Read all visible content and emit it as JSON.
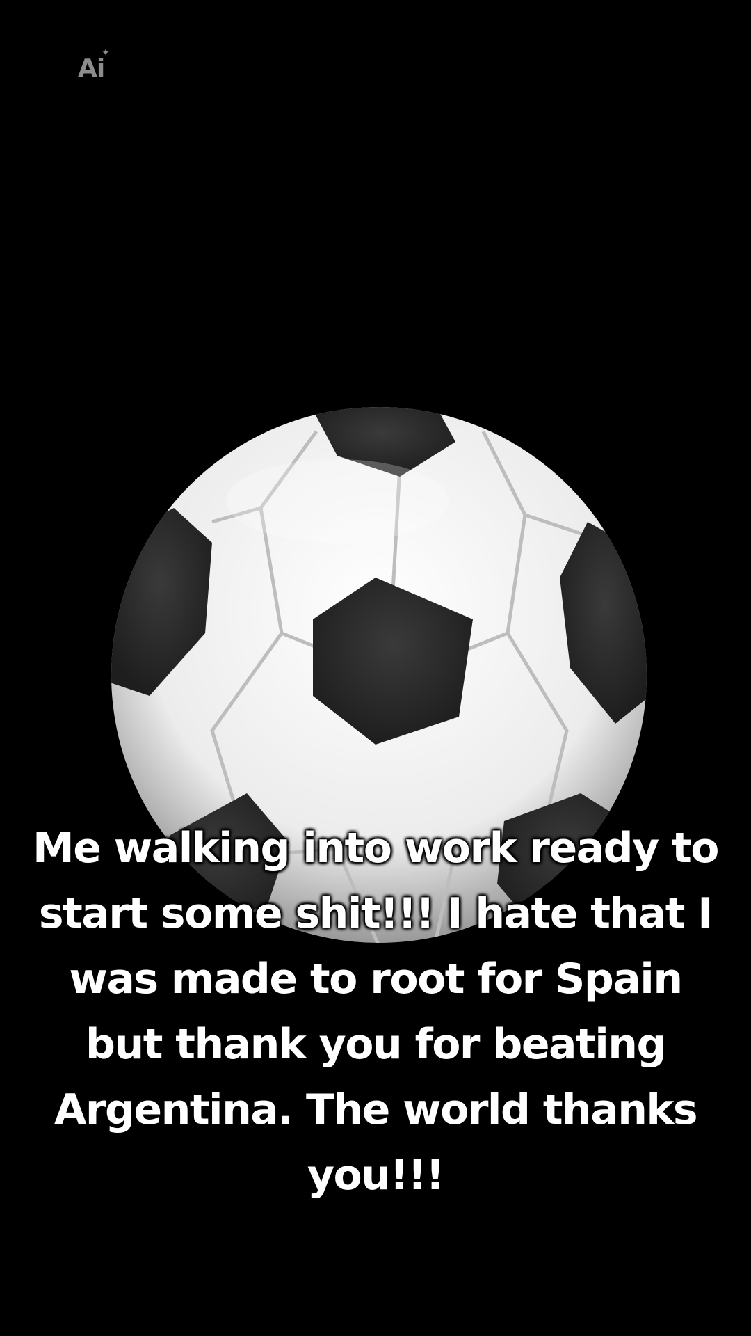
{
  "badge": {
    "label": "Ai"
  },
  "image": {
    "subject": "soccer-ball-icon"
  },
  "caption": {
    "text": "Me walking into work ready to start some shit!!! I hate that I was made to root for Spain but thank you for beating Argentina. The world thanks you!!!"
  },
  "colors": {
    "background": "#000000",
    "caption": "#ffffff",
    "badge": "#8c8c8c"
  }
}
